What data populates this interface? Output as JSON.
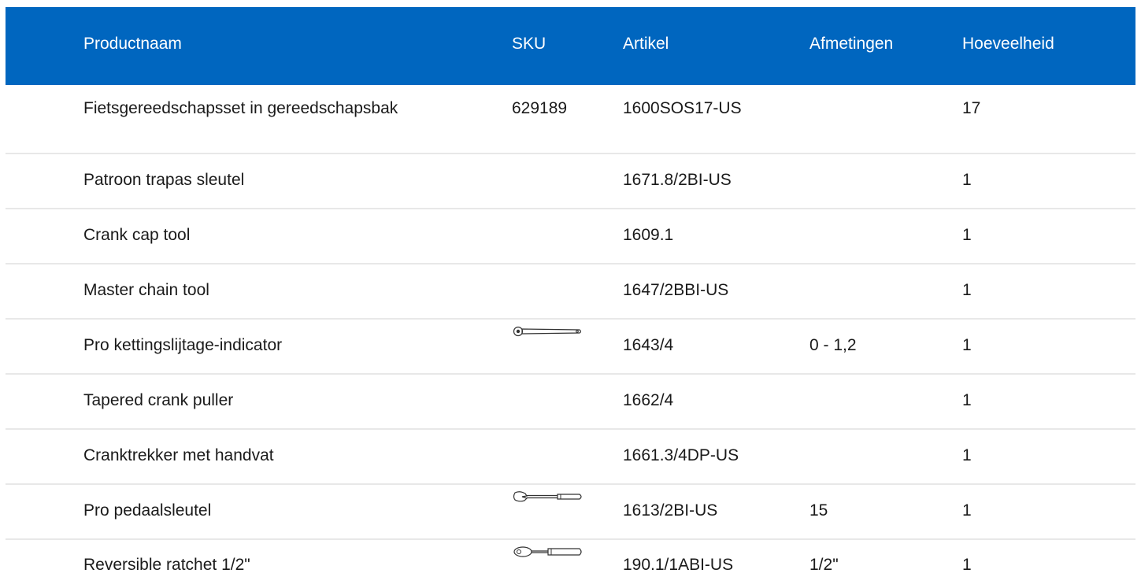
{
  "columns": {
    "name": "Productnaam",
    "sku": "SKU",
    "article": "Artikel",
    "dimensions": "Afmetingen",
    "quantity": "Hoeveelheid"
  },
  "rows": [
    {
      "name": "Fietsgereedschapsset in gereedschapsbak",
      "sku": "629189",
      "article": "1600SOS17-US",
      "dimensions": "",
      "quantity": "17",
      "icon": null
    },
    {
      "name": "Patroon trapas sleutel",
      "sku": "",
      "article": "1671.8/2BI-US",
      "dimensions": "",
      "quantity": "1",
      "icon": null
    },
    {
      "name": "Crank cap tool",
      "sku": "",
      "article": "1609.1",
      "dimensions": "",
      "quantity": "1",
      "icon": null
    },
    {
      "name": "Master chain tool",
      "sku": "",
      "article": "1647/2BBI-US",
      "dimensions": "",
      "quantity": "1",
      "icon": null
    },
    {
      "name": "Pro kettingslijtage-indicator",
      "sku": "",
      "article": "1643/4",
      "dimensions": "0 - 1,2",
      "quantity": "1",
      "icon": "chain-wear-indicator-icon"
    },
    {
      "name": "Tapered crank puller",
      "sku": "",
      "article": "1662/4",
      "dimensions": "",
      "quantity": "1",
      "icon": null
    },
    {
      "name": "Cranktrekker met handvat",
      "sku": "",
      "article": "1661.3/4DP-US",
      "dimensions": "",
      "quantity": "1",
      "icon": null
    },
    {
      "name": "Pro pedaalsleutel",
      "sku": "",
      "article": "1613/2BI-US",
      "dimensions": "15",
      "quantity": "1",
      "icon": "pedal-wrench-icon"
    },
    {
      "name": "Reversible ratchet 1/2\"",
      "sku": "",
      "article": "190.1/1ABI-US",
      "dimensions": "1/2\"",
      "quantity": "1",
      "icon": "ratchet-icon"
    }
  ],
  "colors": {
    "header_bg": "#0066bf",
    "header_text": "#ffffff",
    "divider": "#e8e8e8"
  }
}
